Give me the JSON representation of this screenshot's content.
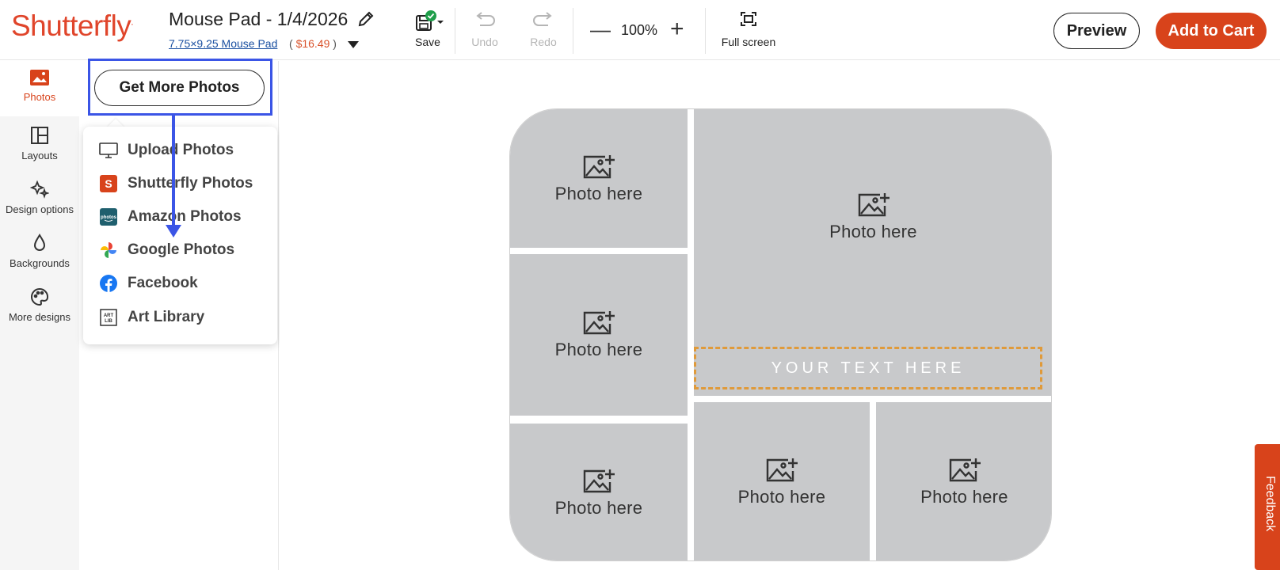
{
  "header": {
    "logo": "Shutterfly",
    "project_title": "Mouse Pad - 1/4/2026",
    "product_link": "7.75×9.25 Mouse Pad",
    "price_open": "(",
    "price": "$16.49",
    "price_close": ")",
    "save_label": "Save",
    "undo_label": "Undo",
    "redo_label": "Redo",
    "zoom_value": "100%",
    "fullscreen_label": "Full screen",
    "preview_label": "Preview",
    "cart_label": "Add to Cart"
  },
  "rail": {
    "items": [
      {
        "label": "Photos"
      },
      {
        "label": "Layouts"
      },
      {
        "label": "Design options"
      },
      {
        "label": "Backgrounds"
      },
      {
        "label": "More designs"
      }
    ]
  },
  "panel": {
    "get_more_label": "Get More Photos",
    "sources": [
      {
        "label": "Upload Photos",
        "icon": "monitor-icon"
      },
      {
        "label": "Shutterfly Photos",
        "icon": "shutterfly-icon"
      },
      {
        "label": "Amazon Photos",
        "icon": "amazon-photos-icon"
      },
      {
        "label": "Google Photos",
        "icon": "google-photos-icon"
      },
      {
        "label": "Facebook",
        "icon": "facebook-icon"
      },
      {
        "label": "Art Library",
        "icon": "art-library-icon"
      }
    ]
  },
  "canvas": {
    "photo_placeholder": "Photo here",
    "text_placeholder": "YOUR TEXT HERE"
  },
  "feedback_label": "Feedback",
  "colors": {
    "brand": "#d8431b",
    "highlight": "#3b55e6",
    "placeholder": "#c8c9cb",
    "text_border": "#e09a3a"
  }
}
